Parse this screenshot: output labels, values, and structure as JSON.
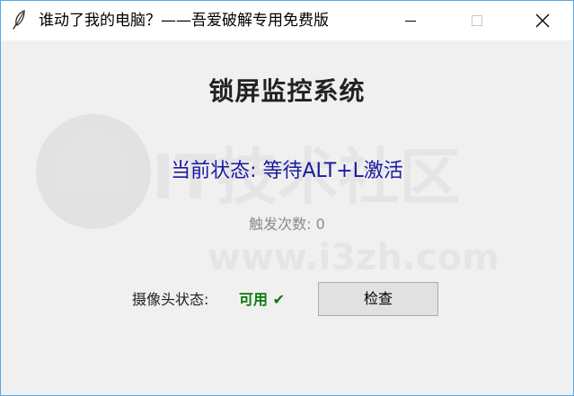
{
  "window": {
    "title": "谁动了我的电脑？——吾爱破解专用免费版",
    "icon": "feather-icon",
    "controls": {
      "minimize_icon": "minimize-icon",
      "maximize_icon": "maximize-icon",
      "close_icon": "close-icon"
    }
  },
  "main": {
    "heading": "锁屏监控系统",
    "status": "当前状态: 等待ALT+L激活",
    "trigger_label": "触发次数: ",
    "trigger_count": "0",
    "camera_label": "摄像头状态:",
    "camera_status": "可用 ✔",
    "check_button": "检查"
  },
  "watermark": {
    "text_cn": "IT技术社区",
    "text_url": "www.i3zh.com"
  },
  "colors": {
    "window_border": "#59a8e6",
    "client_bg": "#f0f0f0",
    "status_text": "#1a1aa0",
    "camera_ok": "#0a7a0a",
    "trigger_text": "#8a8a8a"
  }
}
